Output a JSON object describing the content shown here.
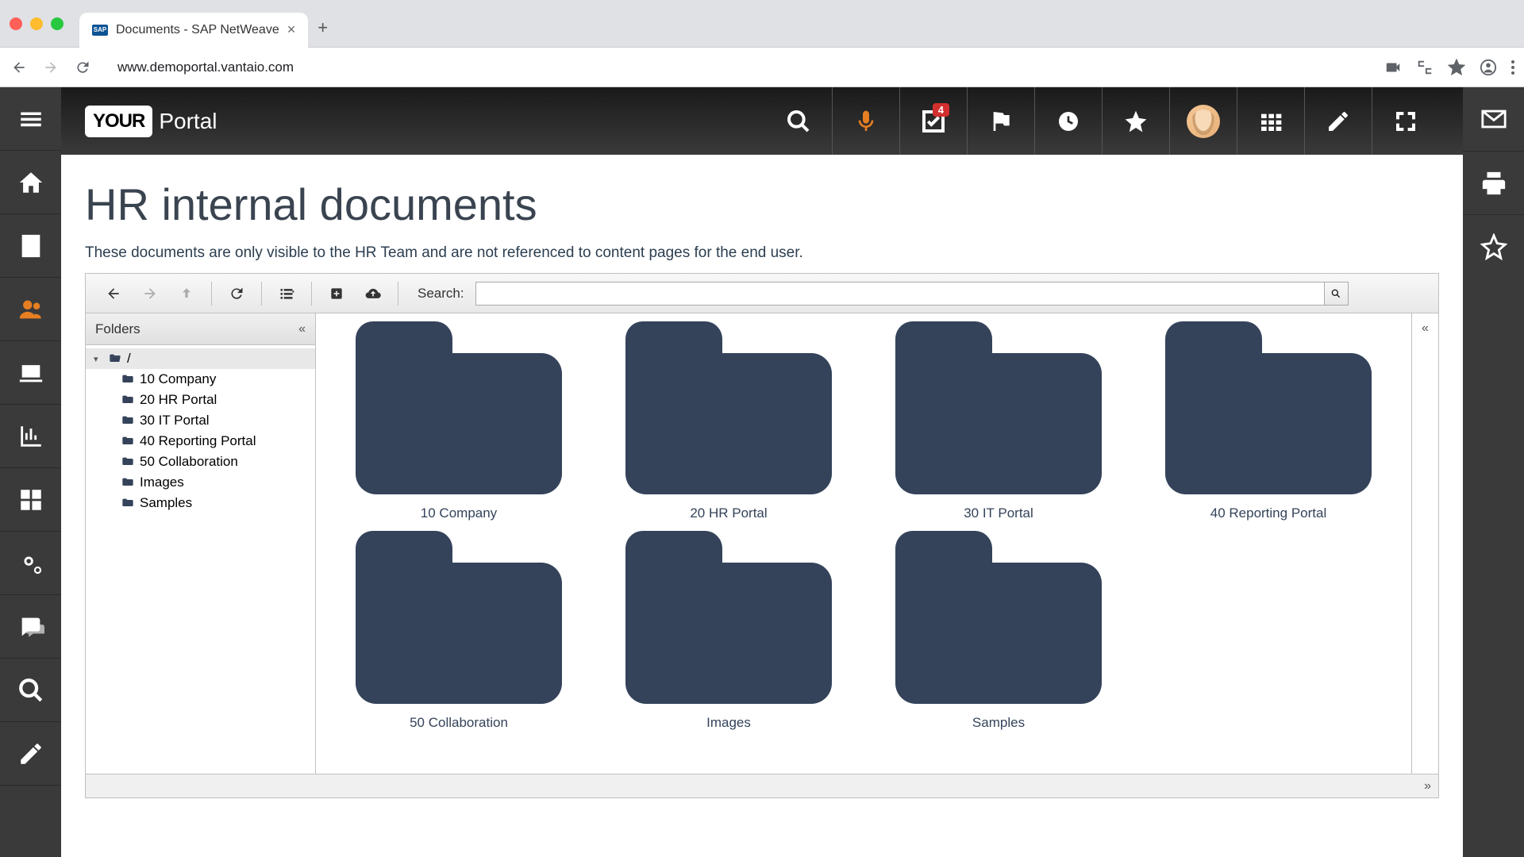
{
  "browser": {
    "tab_title": "Documents - SAP NetWeave",
    "favicon_text": "SAP",
    "url": "www.demoportal.vantaio.com"
  },
  "header": {
    "logo_your": "YOUR",
    "logo_portal": "Portal",
    "badge_count": "4"
  },
  "page": {
    "title": "HR internal documents",
    "subtitle": "These documents are only visible to the HR Team and are not referenced to content pages for the end user."
  },
  "explorer": {
    "search_label": "Search:",
    "search_value": "",
    "folders_header": "Folders",
    "root_label": "/",
    "tree": [
      "10 Company",
      "20 HR Portal",
      "30 IT Portal",
      "40 Reporting Portal",
      "50 Collaboration",
      "Images",
      "Samples"
    ],
    "grid": [
      "10 Company",
      "20 HR Portal",
      "30 IT Portal",
      "40 Reporting Portal",
      "50 Collaboration",
      "Images",
      "Samples"
    ]
  }
}
